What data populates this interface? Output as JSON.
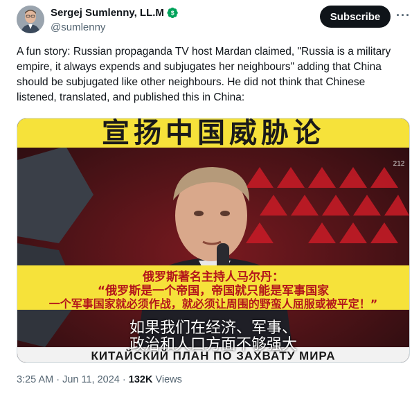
{
  "author": {
    "name": "Sergej Sumlenny, LL.M",
    "handle": "@sumlenny"
  },
  "subscribe_label": "Subscribe",
  "more_label": "···",
  "tweet_text": "A fun story: Russian propaganda TV host Mardan claimed, \"Russia is a military empire, it always expends and subjugates her neighbours\" adding that China should be subjugated like other neighbours. He did not think that Chinese listened, translated, and published this in China:",
  "video": {
    "top_banner": "宣扬中国威胁论",
    "corner_tag": "212",
    "caption_line1": "俄罗斯著名主持人马尔丹：",
    "caption_line2": "“俄罗斯是一个帝国，帝国就只能是军事国家",
    "caption_line3": "一个军事国家就必须作战，就必须让周围的野蛮人屈服或被平定！”",
    "subtitle_line1": "如果我们在经济、军事、",
    "subtitle_line2": "政治和人口方面不够强大",
    "bottom_banner": "КИТАЙСКИЙ ПЛАН ПО ЗАХВАТУ МИРА"
  },
  "meta": {
    "time": "3:25 AM",
    "sep1": " · ",
    "date": "Jun 11, 2024",
    "sep2": " · ",
    "views_count": "132K",
    "views_label": " Views"
  },
  "colors": {
    "verified_badge": "#00a35b",
    "banner_yellow": "#f6e23a",
    "caption_red": "#b3151b"
  },
  "icons": [
    "verified-icon",
    "more-options-icon"
  ]
}
